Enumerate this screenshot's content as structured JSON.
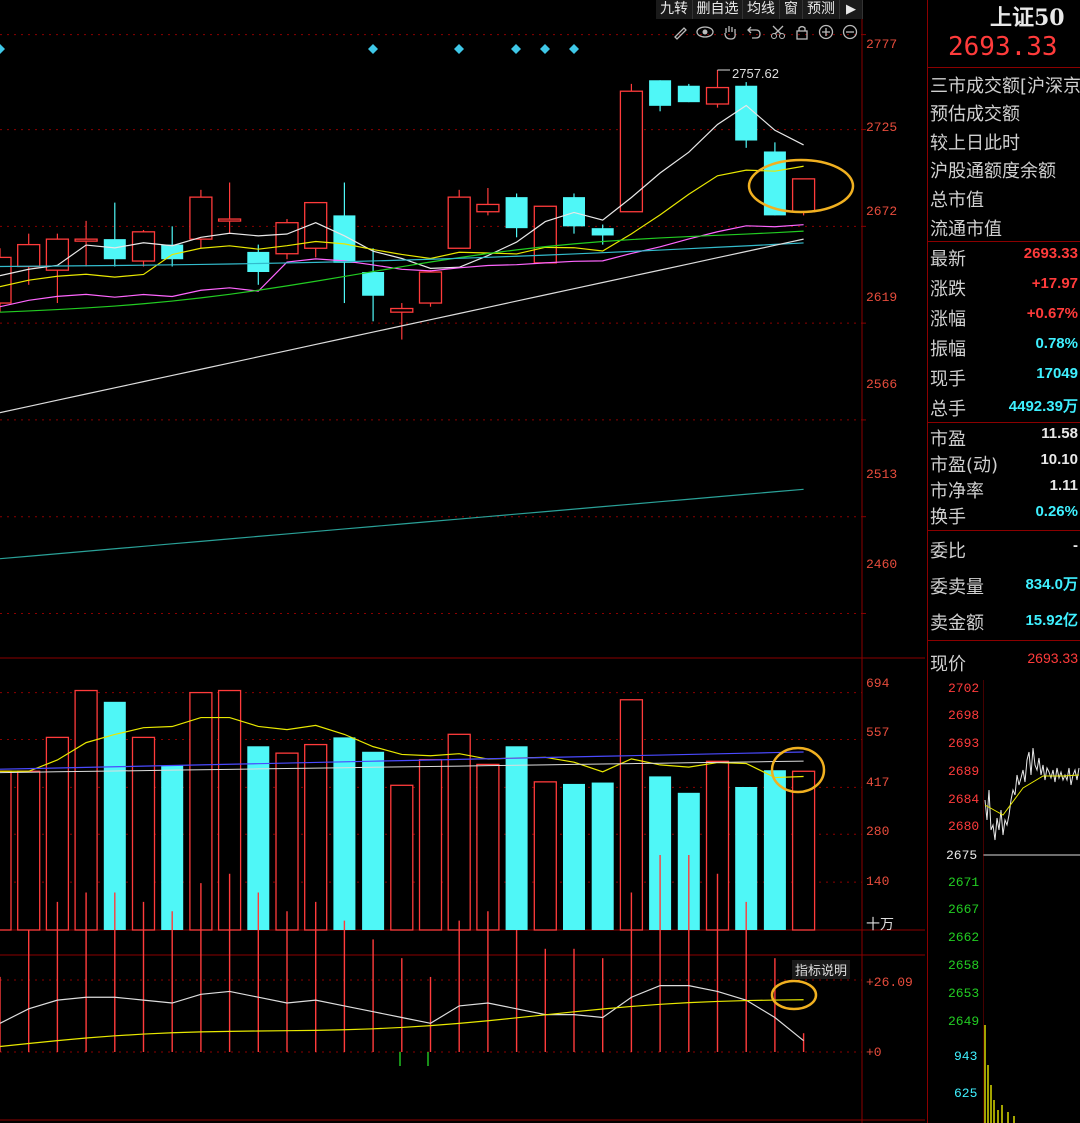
{
  "toolbar": {
    "buttons": [
      "九转",
      "删自选",
      "均线",
      "窗",
      "预测"
    ],
    "tools": [
      "pencil-icon",
      "eye-icon",
      "hand-icon",
      "undo-icon",
      "scissors-icon",
      "lock-icon",
      "zoom-in-icon",
      "zoom-out-icon"
    ]
  },
  "main_chart": {
    "y_ticks": [
      "2777",
      "2725",
      "2672",
      "2619",
      "2566",
      "2513",
      "2460"
    ],
    "high_label": "2757.62"
  },
  "volume_chart": {
    "y_ticks": [
      "694",
      "557",
      "417",
      "280",
      "140"
    ],
    "unit": "十万"
  },
  "indicator_chart": {
    "help_label": "指标说明",
    "y_ticks": [
      "+26.09",
      "+0"
    ]
  },
  "panel": {
    "title": "上证50",
    "price": "2693.33",
    "info_rows": [
      "三市成交额[沪深京",
      "预估成交额",
      "较上日此时",
      "沪股通额度余额",
      "总市值",
      "流通市值"
    ],
    "stats": [
      {
        "label": "最新",
        "value": "2693.33",
        "color": "red"
      },
      {
        "label": "涨跌",
        "value": "+17.97",
        "color": "red"
      },
      {
        "label": "涨幅",
        "value": "+0.67%",
        "color": "red"
      },
      {
        "label": "振幅",
        "value": "0.78%",
        "color": "cyan"
      },
      {
        "label": "现手",
        "value": "17049",
        "color": "cyan"
      },
      {
        "label": "总手",
        "value": "4492.39万",
        "color": "cyan"
      }
    ],
    "stats2": [
      {
        "label": "市盈",
        "value": "11.58",
        "color": "white"
      },
      {
        "label": "市盈(动)",
        "value": "10.10",
        "color": "white"
      },
      {
        "label": "市净率",
        "value": "1.11",
        "color": "white"
      },
      {
        "label": "换手",
        "value": "0.26%",
        "color": "cyan"
      }
    ],
    "stats3": [
      {
        "label": "委比",
        "value": "-",
        "color": "white"
      },
      {
        "label": "委卖量",
        "value": "834.0万",
        "color": "cyan"
      },
      {
        "label": "卖金额",
        "value": "15.92亿",
        "color": "cyan"
      }
    ],
    "now_price_label": "现价",
    "now_price_value": "2693.33",
    "mini_ticks_red": [
      "2702",
      "2698",
      "2693",
      "2689",
      "2684",
      "2680"
    ],
    "mini_tick_base": "2675",
    "mini_ticks_green": [
      "2671",
      "2667",
      "2662",
      "2658",
      "2653",
      "2649"
    ],
    "mini_vol_ticks": [
      "943",
      "625"
    ]
  },
  "colors": {
    "up": "#ff3b3b",
    "down": "#4ff7f7",
    "grid": "#8b0000",
    "ma5": "#e8e8e8",
    "ma10": "#e8e800",
    "ma20": "#ff66ff",
    "ma30": "#22cc22",
    "ma60": "#33bbcc",
    "ma120": "#dddddd",
    "ma250": "#2aa198"
  },
  "chart_data": {
    "type": "candlestick",
    "y_range": [
      2440,
      2785
    ],
    "candles": [
      {
        "o": 2630,
        "h": 2660,
        "l": 2625,
        "c": 2655
      },
      {
        "o": 2650,
        "h": 2668,
        "l": 2640,
        "c": 2662
      },
      {
        "o": 2648,
        "h": 2668,
        "l": 2630,
        "c": 2665
      },
      {
        "o": 2665,
        "h": 2675,
        "l": 2650,
        "c": 2665
      },
      {
        "o": 2665,
        "h": 2685,
        "l": 2650,
        "c": 2654
      },
      {
        "o": 2653,
        "h": 2670,
        "l": 2650,
        "c": 2669
      },
      {
        "o": 2662,
        "h": 2672,
        "l": 2650,
        "c": 2654
      },
      {
        "o": 2665,
        "h": 2692,
        "l": 2660,
        "c": 2688
      },
      {
        "o": 2676,
        "h": 2696,
        "l": 2668,
        "c": 2676
      },
      {
        "o": 2658,
        "h": 2662,
        "l": 2640,
        "c": 2647
      },
      {
        "o": 2657,
        "h": 2676,
        "l": 2654,
        "c": 2674
      },
      {
        "o": 2660,
        "h": 2685,
        "l": 2655,
        "c": 2685
      },
      {
        "o": 2678,
        "h": 2696,
        "l": 2630,
        "c": 2652
      },
      {
        "o": 2647,
        "h": 2660,
        "l": 2620,
        "c": 2634
      },
      {
        "o": 2625,
        "h": 2630,
        "l": 2610,
        "c": 2627
      },
      {
        "o": 2630,
        "h": 2648,
        "l": 2628,
        "c": 2647
      },
      {
        "o": 2660,
        "h": 2692,
        "l": 2660,
        "c": 2688
      },
      {
        "o": 2680,
        "h": 2693,
        "l": 2678,
        "c": 2684
      },
      {
        "o": 2688,
        "h": 2690,
        "l": 2666,
        "c": 2671
      },
      {
        "o": 2652,
        "h": 2683,
        "l": 2652,
        "c": 2683
      },
      {
        "o": 2688,
        "h": 2690,
        "l": 2668,
        "c": 2672
      },
      {
        "o": 2671,
        "h": 2673,
        "l": 2662,
        "c": 2667
      },
      {
        "o": 2680,
        "h": 2750,
        "l": 2680,
        "c": 2746
      },
      {
        "o": 2752,
        "h": 2752,
        "l": 2735,
        "c": 2738
      },
      {
        "o": 2749,
        "h": 2750,
        "l": 2740,
        "c": 2740
      },
      {
        "o": 2739,
        "h": 2757.62,
        "l": 2737,
        "c": 2748
      },
      {
        "o": 2749,
        "h": 2751,
        "l": 2715,
        "c": 2719
      },
      {
        "o": 2713,
        "h": 2718,
        "l": 2678,
        "c": 2678
      },
      {
        "o": 2680,
        "h": 2698,
        "l": 2678,
        "c": 2698
      }
    ],
    "volumes": [
      464,
      464,
      563,
      700,
      667,
      563,
      481,
      694,
      700,
      537,
      517,
      542,
      563,
      521,
      423,
      498,
      572,
      484,
      537,
      433,
      427,
      431,
      673,
      449,
      401,
      493,
      418,
      467,
      464
    ],
    "macd": [
      8,
      13,
      16,
      17,
      17,
      16,
      15,
      18,
      19,
      17,
      15,
      16,
      14,
      12,
      10,
      8,
      14,
      15,
      13,
      11,
      11,
      10,
      17,
      21,
      21,
      19,
      16,
      10,
      2
    ]
  }
}
